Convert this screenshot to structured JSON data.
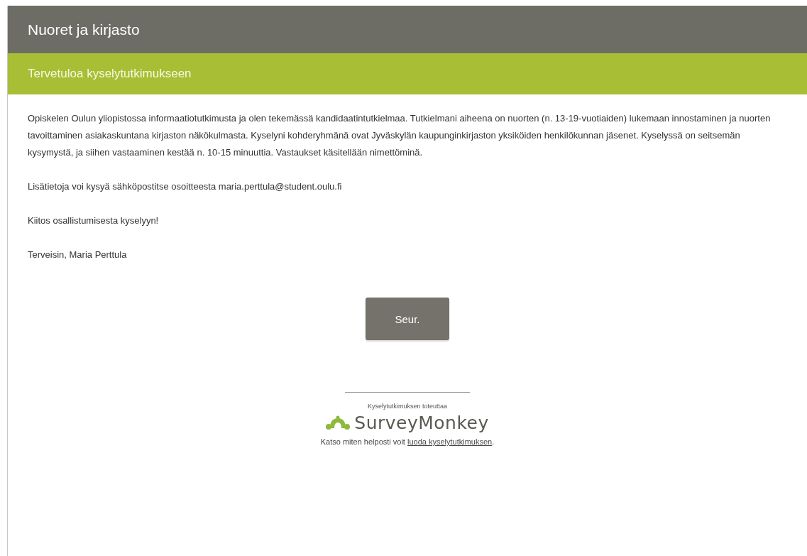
{
  "survey_title": "Nuoret ja kirjasto",
  "page_title": "Tervetuloa kyselytutkimukseen",
  "paragraphs": [
    "Opiskelen Oulun yliopistossa informaatiotutkimusta ja olen tekemässä kandidaatintutkielmaa. Tutkielmani aiheena on nuorten (n. 13-19-vuotiaiden) lukemaan innostaminen ja nuorten tavoittaminen asiakaskuntana kirjaston näkökulmasta. Kyselyni kohderyhmänä ovat Jyväskylän kaupunginkirjaston yksiköiden henkilökunnan jäsenet. Kyselyssä on seitsemän kysymystä, ja siihen vastaaminen kestää n. 10-15 minuuttia. Vastaukset käsitellään nimettöminä.",
    "Lisätietoja voi kysyä sähköpostitse osoitteesta maria.perttula@student.oulu.fi",
    "Kiitos osallistumisesta kyselyyn!",
    "Terveisin, Maria Perttula"
  ],
  "next_button": "Seur.",
  "footer": {
    "powered_by": "Kyselytutkimuksen toteuttaa",
    "logo_text": "SurveyMonkey",
    "cta_text": "Katso miten helposti voit ",
    "cta_link": "luoda kyselytutkimuksen",
    "cta_end": "."
  }
}
